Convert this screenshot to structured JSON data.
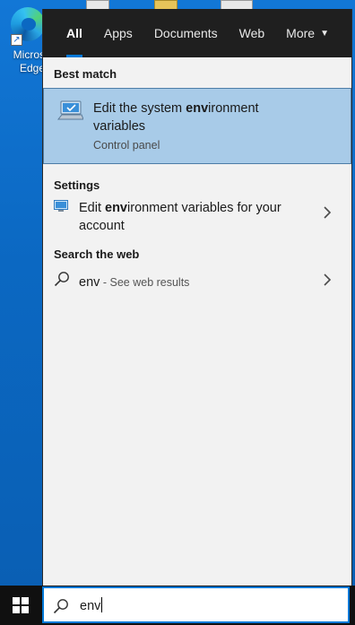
{
  "desktop": {
    "edge_label_line1": "Micros",
    "edge_label_line2": "Edge"
  },
  "tabs": [
    "All",
    "Apps",
    "Documents",
    "Web",
    "More"
  ],
  "best_match": {
    "heading": "Best match",
    "title_pre": "Edit the system ",
    "title_bold": "env",
    "title_post": "ironment variables",
    "subtitle": "Control panel"
  },
  "settings": {
    "heading": "Settings",
    "item_pre": "Edit ",
    "item_bold": "env",
    "item_post": "ironment variables for your account"
  },
  "web": {
    "heading": "Search the web",
    "query": "env",
    "suffix": " - See web results"
  },
  "search": {
    "value": "env"
  },
  "colors": {
    "accent": "#0078d7",
    "selection": "#a8cbe8",
    "panel_bg": "#f2f2f2",
    "tab_bar": "#1f1f1f"
  }
}
